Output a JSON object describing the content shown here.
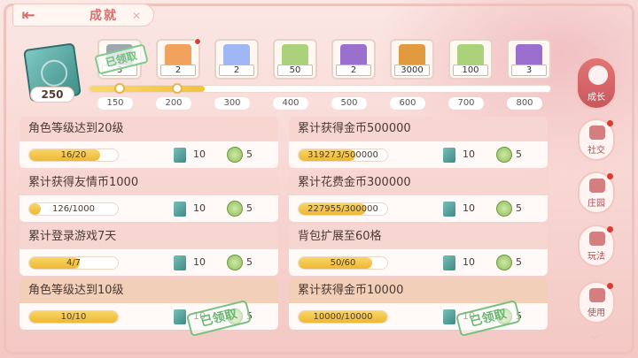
{
  "header": {
    "title": "成就",
    "back_icon": "back-arrow-icon"
  },
  "total_points": "250",
  "rewards": [
    {
      "count": "3",
      "icon": "locked-chest-icon",
      "claimed": true,
      "claimed_label": "已领取",
      "color": "#9da7b0"
    },
    {
      "count": "2",
      "icon": "card-bundle-icon",
      "claimed": false,
      "color": "#f1a35d"
    },
    {
      "count": "2",
      "icon": "heart-gem-icon",
      "claimed": false,
      "color": "#9fb7f4"
    },
    {
      "count": "50",
      "icon": "jade-coin-icon",
      "claimed": false,
      "color": "#a9d27b"
    },
    {
      "count": "2",
      "icon": "purple-crystal-icon",
      "claimed": false,
      "color": "#9a6fce"
    },
    {
      "count": "3000",
      "icon": "gold-coin-icon",
      "claimed": false,
      "color": "#e19b3e"
    },
    {
      "count": "100",
      "icon": "jade-coin-icon",
      "claimed": false,
      "color": "#a9d27b"
    },
    {
      "count": "3",
      "icon": "purple-crystal-icon",
      "claimed": false,
      "color": "#9a6fce"
    }
  ],
  "milestones": [
    "150",
    "200",
    "300",
    "400",
    "500",
    "600",
    "700",
    "800"
  ],
  "achievements_left": [
    {
      "title": "角色等级达到20级",
      "progress": "16/20",
      "ratio": 0.8,
      "ticket": "10",
      "coin": "5",
      "done": false
    },
    {
      "title": "累计获得友情币1000",
      "progress": "126/1000",
      "ratio": 0.126,
      "ticket": "10",
      "coin": "5",
      "done": false
    },
    {
      "title": "累计登录游戏7天",
      "progress": "4/7",
      "ratio": 0.57,
      "ticket": "10",
      "coin": "5",
      "done": false
    },
    {
      "title": "角色等级达到10级",
      "progress": "10/10",
      "ratio": 1,
      "ticket": "10",
      "coin": "5",
      "done": true
    }
  ],
  "achievements_right": [
    {
      "title": "累计获得金币500000",
      "progress": "319273/500000",
      "ratio": 0.64,
      "ticket": "10",
      "coin": "5",
      "done": false
    },
    {
      "title": "累计花费金币300000",
      "progress": "227955/300000",
      "ratio": 0.76,
      "ticket": "10",
      "coin": "5",
      "done": false
    },
    {
      "title": "背包扩展至60格",
      "progress": "50/60",
      "ratio": 0.83,
      "ticket": "10",
      "coin": "5",
      "done": false
    },
    {
      "title": "累计获得金币10000",
      "progress": "10000/10000",
      "ratio": 1,
      "ticket": "10",
      "coin": "5",
      "done": true
    }
  ],
  "claimed_label": "已领取",
  "side_nav": [
    {
      "label": "成长",
      "active": true,
      "icon": "growth-icon"
    },
    {
      "label": "社交",
      "active": false,
      "icon": "chat-icon",
      "dot": true
    },
    {
      "label": "庄园",
      "active": false,
      "icon": "manor-icon",
      "dot": true
    },
    {
      "label": "玩法",
      "active": false,
      "icon": "gamepad-icon",
      "dot": true
    },
    {
      "label": "使用",
      "active": false,
      "icon": "lotus-icon",
      "dot": true
    }
  ]
}
